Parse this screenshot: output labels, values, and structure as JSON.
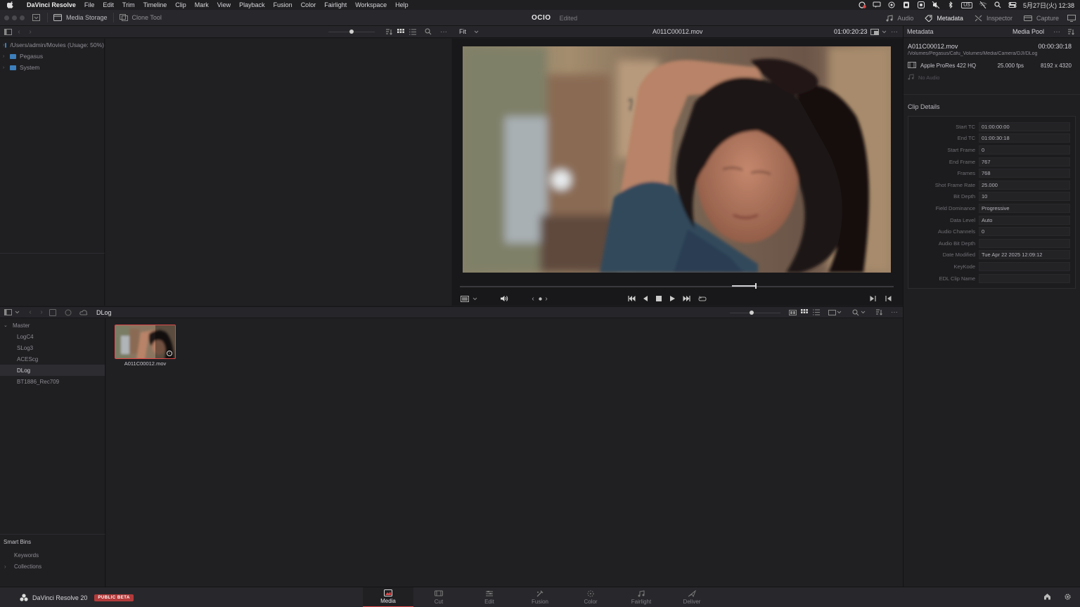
{
  "menubar": {
    "app_name": "DaVinci Resolve",
    "items": [
      "File",
      "Edit",
      "Trim",
      "Timeline",
      "Clip",
      "Mark",
      "View",
      "Playback",
      "Fusion",
      "Color",
      "Fairlight",
      "Workspace",
      "Help"
    ],
    "datetime": "5月27日(火) 12:38",
    "input_source": "US"
  },
  "toolbar": {
    "media_storage": "Media Storage",
    "clone_tool": "Clone Tool",
    "project_name": "OCIO",
    "status": "Edited",
    "audio": "Audio",
    "metadata": "Metadata",
    "inspector": "Inspector",
    "capture": "Capture"
  },
  "storage": {
    "items": [
      {
        "label": "/Users/admin/Movies (Usage: 50%)"
      },
      {
        "label": "Pegasus"
      },
      {
        "label": "System"
      }
    ]
  },
  "viewer": {
    "zoom": "Fit",
    "clip_name": "A011C00012.mov",
    "timecode": "01:00:20:23"
  },
  "metadata": {
    "title": "Metadata",
    "pool_label": "Media Pool",
    "clip_name": "A011C00012.mov",
    "duration": "00:00:30:18",
    "path": "/Volumes/Pegasus/Cafu_Volumes/Media/Camera/DJI/DLog",
    "codec": "Apple ProRes 422 HQ",
    "fps": "25.000 fps",
    "resolution": "8192 x 4320",
    "audio": "No Audio",
    "section_title": "Clip Details",
    "fields": [
      {
        "label": "Start TC",
        "value": "01:00:00:00"
      },
      {
        "label": "End TC",
        "value": "01:00:30:18"
      },
      {
        "label": "Start Frame",
        "value": "0"
      },
      {
        "label": "End Frame",
        "value": "767"
      },
      {
        "label": "Frames",
        "value": "768"
      },
      {
        "label": "Shot Frame Rate",
        "value": "25.000"
      },
      {
        "label": "Bit Depth",
        "value": "10"
      },
      {
        "label": "Field Dominance",
        "value": "Progressive"
      },
      {
        "label": "Data Level",
        "value": "Auto"
      },
      {
        "label": "Audio Channels",
        "value": "0"
      },
      {
        "label": "Audio Bit Depth",
        "value": ""
      },
      {
        "label": "Date Modified",
        "value": "Tue Apr 22 2025 12:09:12"
      },
      {
        "label": "KeyKode",
        "value": ""
      },
      {
        "label": "EDL Clip Name",
        "value": ""
      }
    ]
  },
  "pool": {
    "current_bin": "DLog",
    "bins": [
      "Master",
      "LogC4",
      "SLog3",
      "ACEScg",
      "DLog",
      "BT1886_Rec709"
    ],
    "selected_bin": "DLog",
    "smart_bins_title": "Smart Bins",
    "smart_bins": [
      "Keywords",
      "Collections"
    ],
    "clips": [
      {
        "name": "A011C00012.mov"
      }
    ]
  },
  "bottom": {
    "brand": "DaVinci Resolve 20",
    "badge": "PUBLIC BETA",
    "pages": [
      "Media",
      "Cut",
      "Edit",
      "Fusion",
      "Color",
      "Fairlight",
      "Deliver"
    ],
    "active_page": "Media"
  },
  "colors": {
    "accent": "#e04848",
    "background": "#1c1c1f",
    "panel": "#28282c"
  }
}
